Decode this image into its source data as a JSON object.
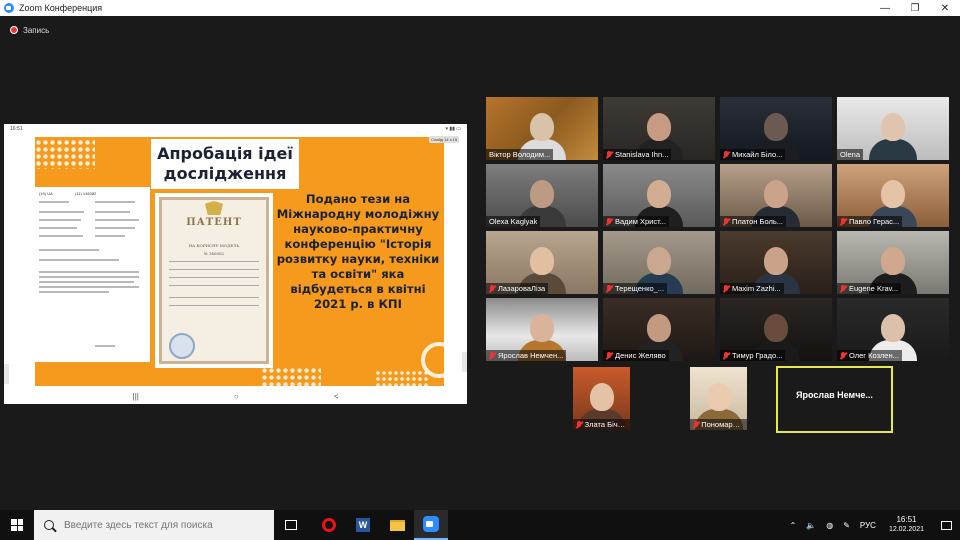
{
  "window": {
    "title": "Zoom Конференция",
    "minimize_icon": "—",
    "restore_icon": "❐",
    "close_icon": "✕"
  },
  "recording": {
    "label": "Запись"
  },
  "share": {
    "status_time": "16:51",
    "page_indicator": "Слайд 14 з 15",
    "slide": {
      "title_line1": "Апробація ідеї",
      "title_line2": "дослідження",
      "body": "Подано тези на Міжнародну молодіжну науково-практичну конференцію \"Історія розвитку науки, техніки та освіти\" яка відбудеться в квітні 2021 р. в КПІ",
      "patent_word": "ПАТЕНТ",
      "patent_sub1": "НА КОРИСНУ МОДЕЛЬ",
      "patent_sub2": "№ 146082",
      "doc_number": "(11) 146082",
      "doc_code": "(19) UA"
    },
    "nav": {
      "recent": "|||",
      "home": "○",
      "back": "<"
    }
  },
  "participants": [
    {
      "name": "Віктор Володим...",
      "muted": false
    },
    {
      "name": "Stanislava Ihn...",
      "muted": true
    },
    {
      "name": "Михайл Біло...",
      "muted": true
    },
    {
      "name": "Olena",
      "muted": false
    },
    {
      "name": "Olexa Kaglyak",
      "muted": false
    },
    {
      "name": "Вадим Христ...",
      "muted": true
    },
    {
      "name": "Платон Боль...",
      "muted": true
    },
    {
      "name": "Павло Герас...",
      "muted": true
    },
    {
      "name": "ЛазароваЛіза",
      "muted": true
    },
    {
      "name": "Терещенко_...",
      "muted": true
    },
    {
      "name": "Maxim Zazhi...",
      "muted": true
    },
    {
      "name": "Eugene Krav...",
      "muted": true
    },
    {
      "name": "Ярослав Немчен...",
      "muted": true
    },
    {
      "name": "Денис Желяво",
      "muted": true
    },
    {
      "name": "Тимур Градо...",
      "muted": true
    },
    {
      "name": "Олег Козлен...",
      "muted": true
    },
    {
      "name": "Злата Бічева",
      "muted": true
    },
    {
      "name": "Пономаренк...",
      "muted": true
    },
    {
      "name": "Ярослав Немче...",
      "muted": false
    }
  ],
  "taskbar": {
    "search_placeholder": "Введите здесь текст для поиска",
    "word_letter": "W",
    "language": "РУС",
    "time": "16:51",
    "date": "12.02.2021",
    "tray_chevron": "⌃",
    "volume_icon": "🔈",
    "network_icon": "◍",
    "keyboard_icon": "✎"
  }
}
